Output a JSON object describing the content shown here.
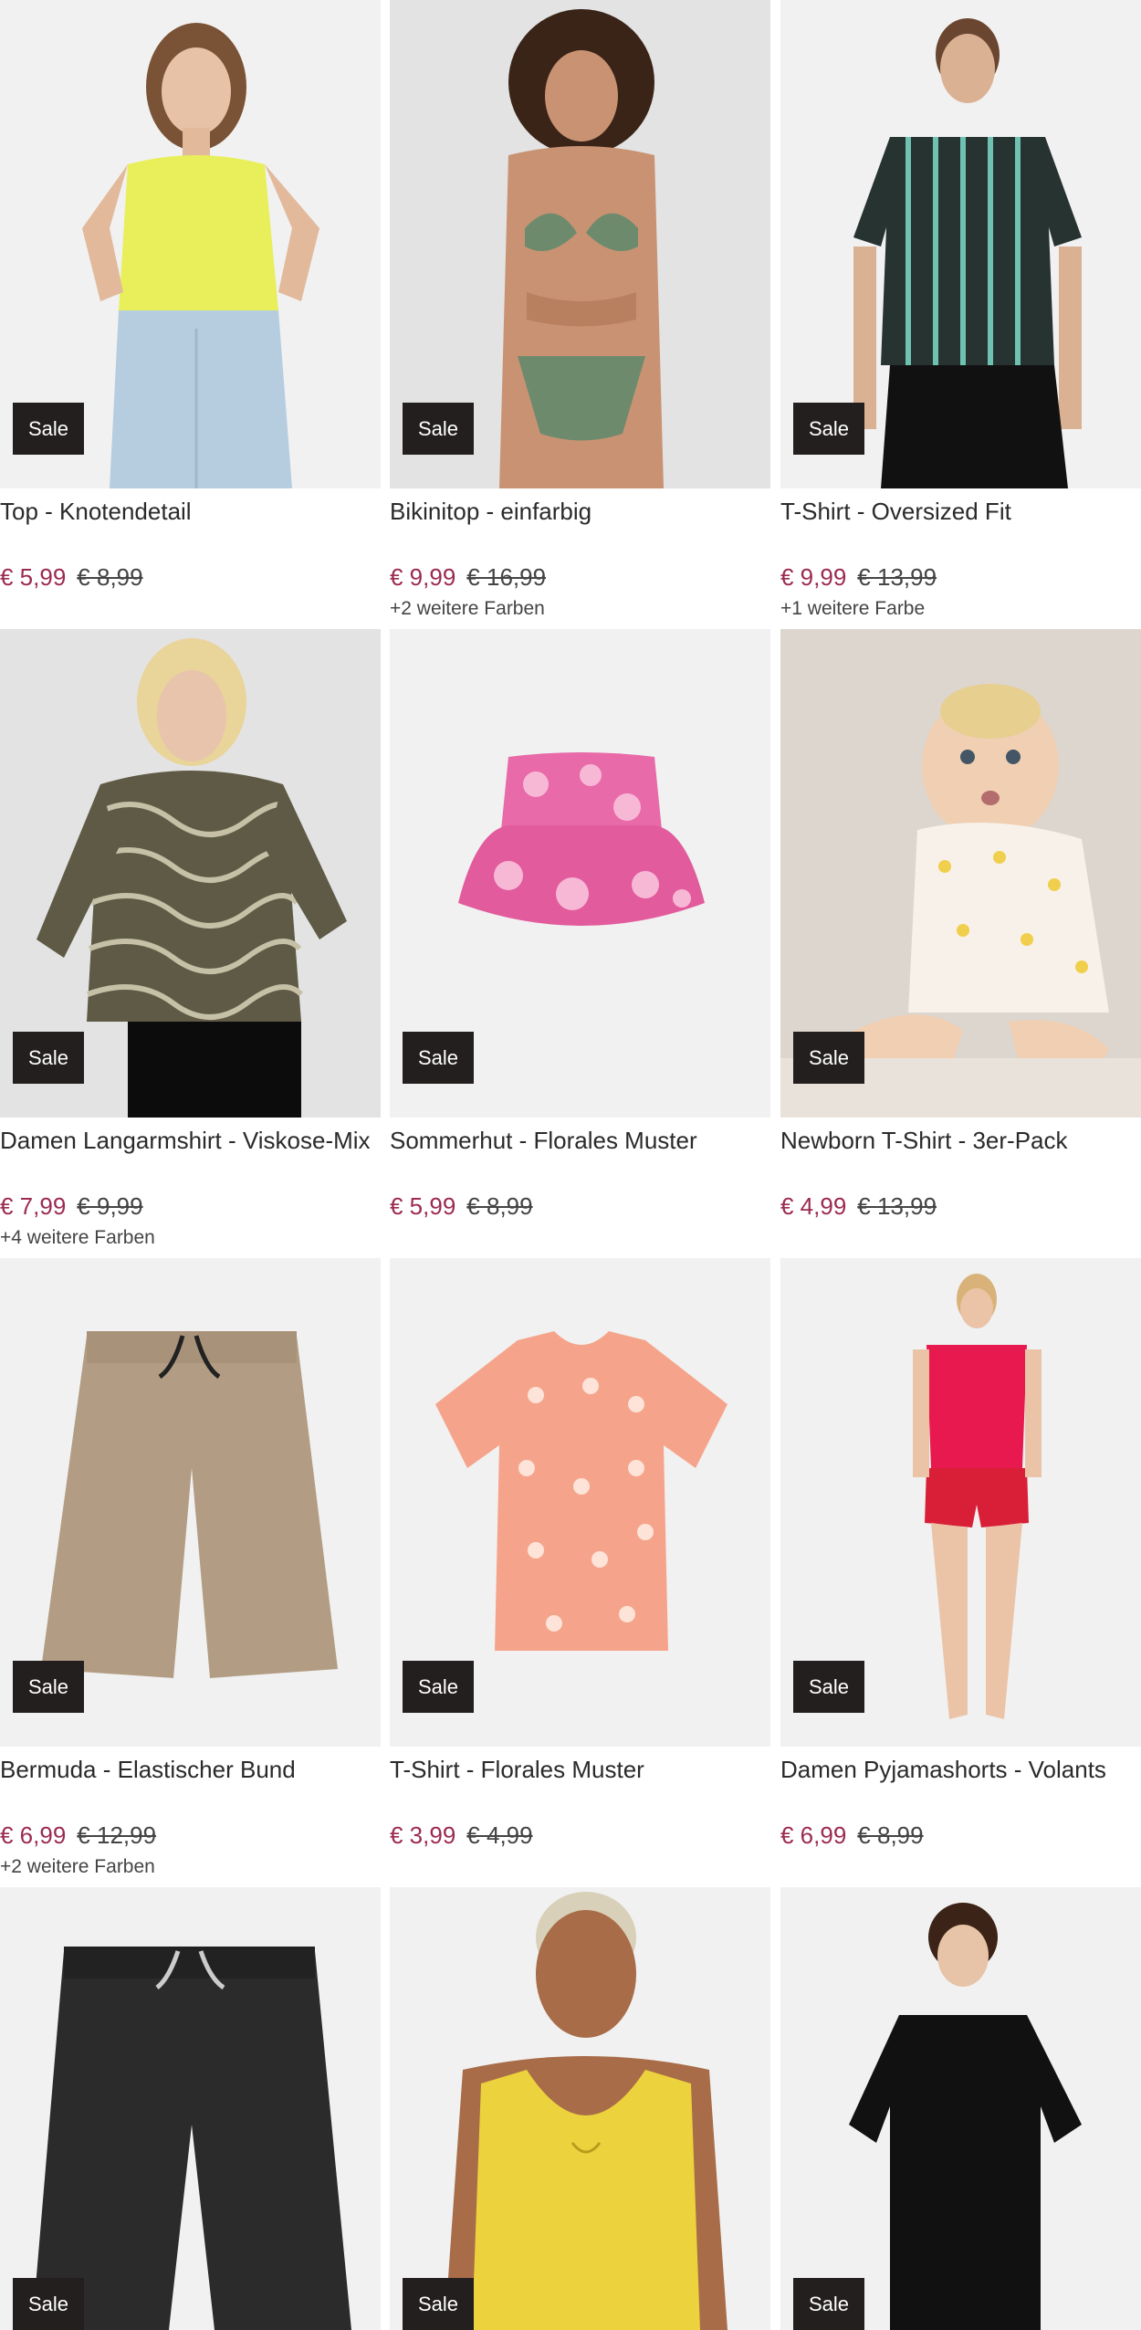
{
  "sale_label": "Sale",
  "colors": {
    "price_now": "#9c2a52",
    "badge_bg": "#231f1e"
  },
  "products": [
    {
      "title": "Top - Knotendetail",
      "price_now": "€ 5,99",
      "price_old": "€ 8,99",
      "more_colors": "",
      "image": "woman-yellow-knot-top"
    },
    {
      "title": "Bikinitop - einfarbig",
      "price_now": "€ 9,99",
      "price_old": "€ 16,99",
      "more_colors": "+2 weitere Farben",
      "image": "woman-green-bikini"
    },
    {
      "title": "T-Shirt - Oversized Fit",
      "price_now": "€ 9,99",
      "price_old": "€ 13,99",
      "more_colors": "+1 weitere Farbe",
      "image": "man-striped-tshirt"
    },
    {
      "title": "Damen Langarmshirt - Viskose-Mix",
      "price_now": "€ 7,99",
      "price_old": "€ 9,99",
      "more_colors": "+4 weitere Farben",
      "image": "woman-wave-pattern-shirt"
    },
    {
      "title": "Sommerhut - Florales Muster",
      "price_now": "€ 5,99",
      "price_old": "€ 8,99",
      "more_colors": "",
      "image": "pink-floral-bucket-hat"
    },
    {
      "title": "Newborn T-Shirt - 3er-Pack",
      "price_now": "€ 4,99",
      "price_old": "€ 13,99",
      "more_colors": "",
      "image": "baby-floral-tshirt"
    },
    {
      "title": "Bermuda - Elastischer Bund",
      "price_now": "€ 6,99",
      "price_old": "€ 12,99",
      "more_colors": "+2 weitere Farben",
      "image": "beige-bermuda-shorts"
    },
    {
      "title": "T-Shirt - Florales Muster",
      "price_now": "€ 3,99",
      "price_old": "€ 4,99",
      "more_colors": "",
      "image": "peach-floral-tshirt"
    },
    {
      "title": "Damen Pyjamashorts - Volants",
      "price_now": "€ 6,99",
      "price_old": "€ 8,99",
      "more_colors": "",
      "image": "woman-red-pyjama"
    },
    {
      "title": "",
      "price_now": "",
      "price_old": "",
      "more_colors": "",
      "image": "black-bermuda-shorts"
    },
    {
      "title": "",
      "price_now": "",
      "price_old": "",
      "more_colors": "",
      "image": "woman-yellow-top"
    },
    {
      "title": "",
      "price_now": "",
      "price_old": "",
      "more_colors": "",
      "image": "woman-black-tshirt"
    }
  ]
}
